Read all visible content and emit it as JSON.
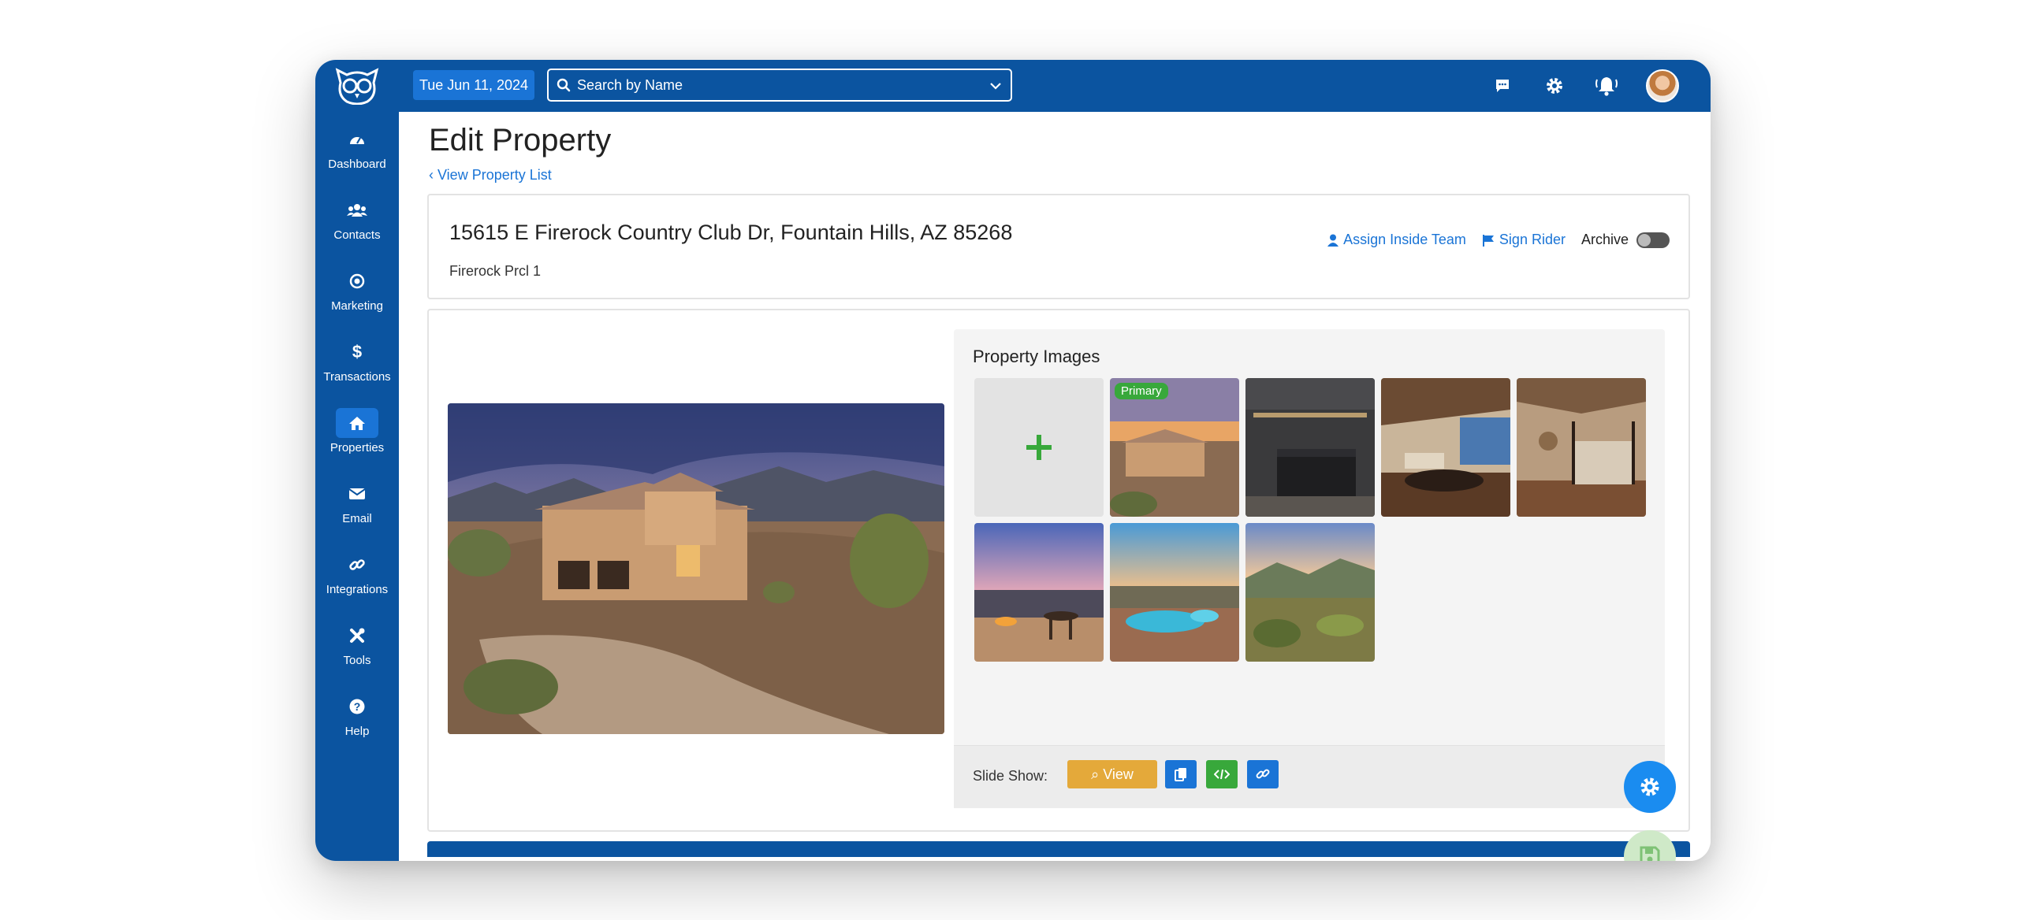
{
  "header": {
    "date": "Tue Jun 11, 2024",
    "search_placeholder": "Search by Name",
    "icons": [
      "chat-icon",
      "gear-icon",
      "bell-icon"
    ]
  },
  "sidebar": {
    "items": [
      {
        "label": "Dashboard",
        "icon": "gauge-icon"
      },
      {
        "label": "Contacts",
        "icon": "users-icon"
      },
      {
        "label": "Marketing",
        "icon": "target-icon"
      },
      {
        "label": "Transactions",
        "icon": "dollar-icon"
      },
      {
        "label": "Properties",
        "icon": "home-icon",
        "active": true
      },
      {
        "label": "Email",
        "icon": "envelope-icon"
      },
      {
        "label": "Integrations",
        "icon": "link-icon"
      },
      {
        "label": "Tools",
        "icon": "tools-icon"
      },
      {
        "label": "Help",
        "icon": "help-icon"
      }
    ]
  },
  "page": {
    "title": "Edit Property",
    "back_link": "View Property List"
  },
  "property": {
    "address": "15615 E Firerock Country Club Dr, Fountain Hills, AZ 85268",
    "subdivision": "Firerock Prcl 1",
    "assign_team": "Assign Inside Team",
    "sign_rider": "Sign Rider",
    "archive_label": "Archive",
    "archived": false
  },
  "images": {
    "title": "Property Images",
    "primary_badge": "Primary",
    "thumbnails": [
      "exterior-aerial",
      "kitchen",
      "living-room",
      "bedroom",
      "patio-dining",
      "pool",
      "desert-landscape"
    ]
  },
  "slideshow": {
    "label": "Slide Show:",
    "view_button": "View"
  },
  "colors": {
    "brand": "#0b54a0",
    "accent": "#1a74d6",
    "primary_badge": "#38a83b",
    "view_button": "#e4a93a"
  }
}
